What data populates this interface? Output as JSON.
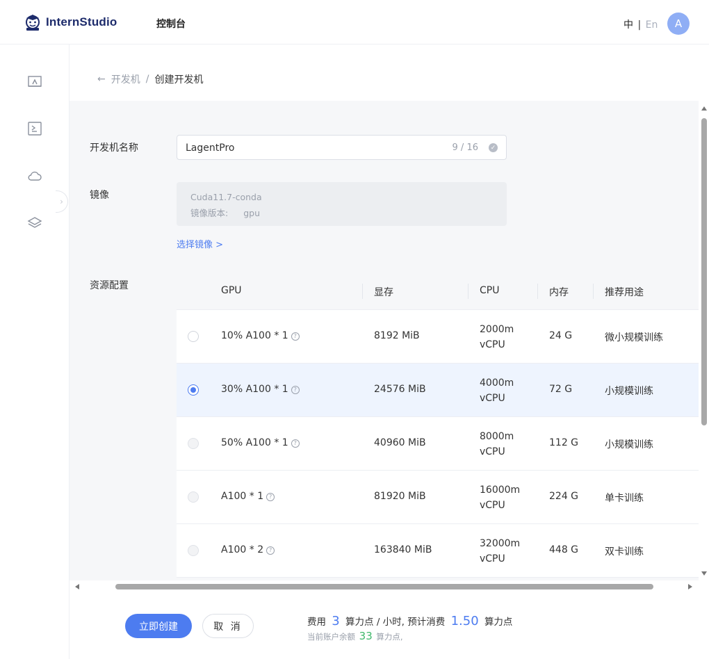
{
  "header": {
    "logo_text": "InternStudio",
    "nav_console": "控制台",
    "lang_zh": "中",
    "lang_sep": "|",
    "lang_en": "En",
    "avatar_letter": "A"
  },
  "sidebar": {
    "items": [
      {
        "icon": "desktop-icon"
      },
      {
        "icon": "terminal-icon"
      },
      {
        "icon": "cloud-icon"
      },
      {
        "icon": "layers-icon"
      }
    ],
    "collapse_glyph": "›"
  },
  "breadcrumb": {
    "back_glyph": "←",
    "parent": "开发机",
    "separator": "/",
    "current": "创建开发机"
  },
  "form": {
    "name_label": "开发机名称",
    "name_value": "LagentPro",
    "name_count": "9 / 16",
    "image_label": "镜像",
    "image_name": "Cuda11.7-conda",
    "image_version_label": "镜像版本:",
    "image_version_value": "gpu",
    "choose_image": "选择镜像 >",
    "resource_label": "资源配置"
  },
  "table": {
    "headers": {
      "gpu": "GPU",
      "vram": "显存",
      "cpu": "CPU",
      "memory": "内存",
      "usage": "推荐用途"
    },
    "rows": [
      {
        "gpu": "10% A100 * 1",
        "vram": "8192 MiB",
        "cpu_top": "2000m",
        "cpu_bottom": "vCPU",
        "memory": "24 G",
        "usage": "微小规模训练",
        "state": "available"
      },
      {
        "gpu": "30% A100 * 1",
        "vram": "24576 MiB",
        "cpu_top": "4000m",
        "cpu_bottom": "vCPU",
        "memory": "72 G",
        "usage": "小规模训练",
        "state": "selected"
      },
      {
        "gpu": "50% A100 * 1",
        "vram": "40960 MiB",
        "cpu_top": "8000m",
        "cpu_bottom": "vCPU",
        "memory": "112 G",
        "usage": "小规模训练",
        "state": "disabled"
      },
      {
        "gpu": "A100 * 1",
        "vram": "81920 MiB",
        "cpu_top": "16000m",
        "cpu_bottom": "vCPU",
        "memory": "224 G",
        "usage": "单卡训练",
        "state": "disabled"
      },
      {
        "gpu": "A100 * 2",
        "vram": "163840 MiB",
        "cpu_top": "32000m",
        "cpu_bottom": "vCPU",
        "memory": "448 G",
        "usage": "双卡训练",
        "state": "disabled"
      }
    ],
    "help_glyph": "?"
  },
  "footer": {
    "create_button": "立即创建",
    "cancel_button": "取 消",
    "fee_prefix": "费用",
    "fee_rate": "3",
    "fee_rate_unit": "算力点 / 小时, 预计消费",
    "fee_total": "1.50",
    "fee_total_unit": "算力点",
    "balance_prefix": "当前账户余额",
    "balance_value": "33",
    "balance_unit": "算力点,"
  },
  "colors": {
    "accent": "#4d7cf0",
    "balance_green": "#3fb86b",
    "selected_row": "#eef4fe",
    "avatar": "#8faef5"
  }
}
